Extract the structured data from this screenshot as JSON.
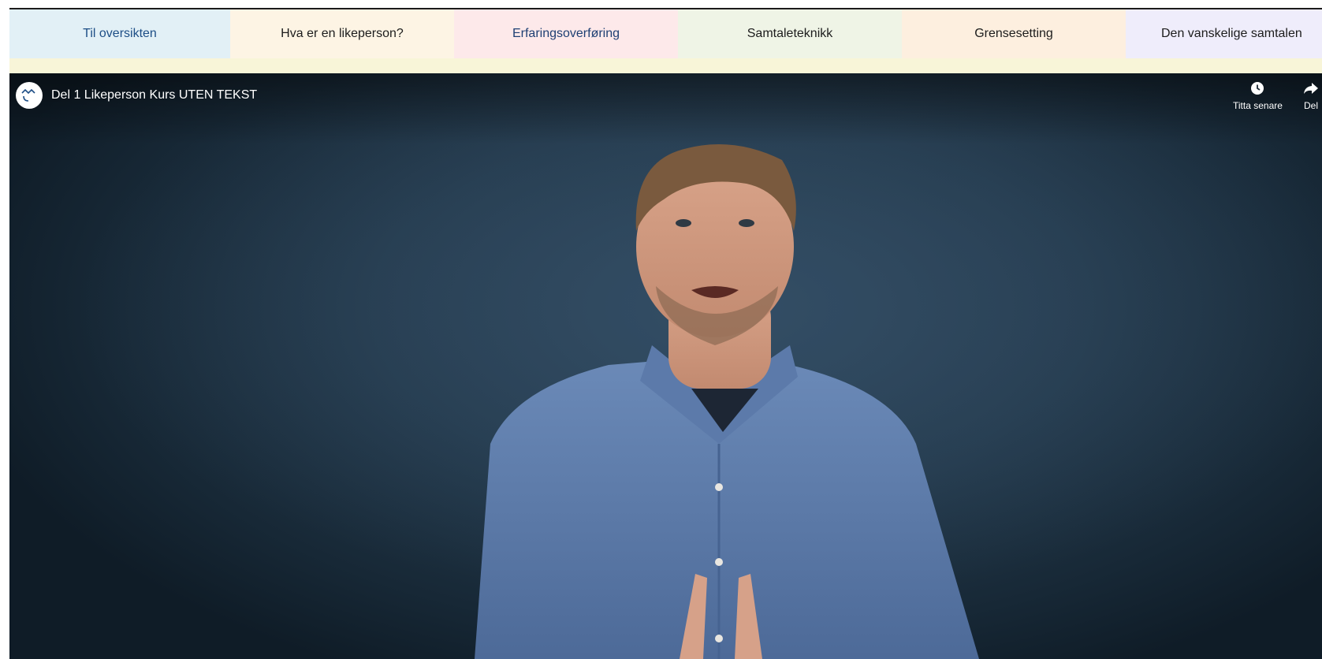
{
  "nav": {
    "tabs": [
      {
        "label": "Til oversikten",
        "bg": "#e2f0f6"
      },
      {
        "label": "Hva er en likeperson?",
        "bg": "#fdf4e4"
      },
      {
        "label": "Erfaringsoverføring",
        "bg": "#fde9ea"
      },
      {
        "label": "Samtaleteknikk",
        "bg": "#eff4e6"
      },
      {
        "label": "Grensesetting",
        "bg": "#fdefdf"
      },
      {
        "label": "Den vanskelige samtalen",
        "bg": "#efedfb"
      }
    ],
    "strip_color": "#f8f5d8"
  },
  "video": {
    "title": "Del 1 Likeperson Kurs UTEN TEKST",
    "actions": {
      "watch_later": "Titta senare",
      "share": "Del"
    }
  },
  "icons": {
    "channel": "channel-logo-icon",
    "watch_later": "clock-icon",
    "share": "share-arrow-icon"
  }
}
